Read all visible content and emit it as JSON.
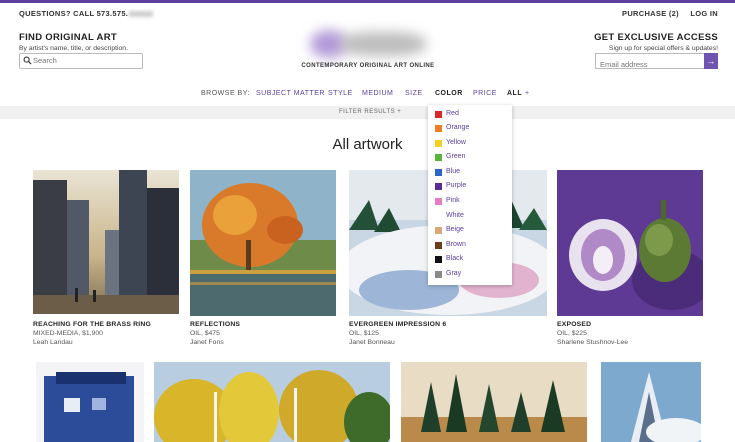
{
  "topbar": {
    "questions": "QUESTIONS? CALL 573.575.",
    "purchase": "PURCHASE (2)",
    "login": "LOG IN"
  },
  "find": {
    "heading": "FIND ORIGINAL ART",
    "subtitle": "By artist's name, title, or description.",
    "search_placeholder": "Search"
  },
  "logo": {
    "tagline": "CONTEMPORARY ORIGINAL ART ONLINE"
  },
  "exclusive": {
    "heading": "GET EXCLUSIVE ACCESS",
    "subtitle": "Sign up for special offers & updates!",
    "email_placeholder": "Email address",
    "submit_arrow": "→"
  },
  "nav": {
    "browse_label": "BROWSE BY:",
    "items": [
      "SUBJECT MATTER",
      "STYLE",
      "MEDIUM",
      "SIZE",
      "COLOR",
      "PRICE",
      "ALL",
      "+"
    ]
  },
  "filter": {
    "label": "FILTER RESULTS +"
  },
  "page_title": "All artwork",
  "color_menu": [
    {
      "label": "Red",
      "color": "#d8262b"
    },
    {
      "label": "Orange",
      "color": "#ef7d22"
    },
    {
      "label": "Yellow",
      "color": "#f4d122"
    },
    {
      "label": "Green",
      "color": "#5bb33a"
    },
    {
      "label": "Blue",
      "color": "#2a67c4"
    },
    {
      "label": "Purple",
      "color": "#5b2b98"
    },
    {
      "label": "Pink",
      "color": "#e77cc0"
    },
    {
      "label": "White",
      "color": "#ffffff"
    },
    {
      "label": "Beige",
      "color": "#d7a877"
    },
    {
      "label": "Brown",
      "color": "#6d3d1f"
    },
    {
      "label": "Black",
      "color": "#111111"
    },
    {
      "label": "Gray",
      "color": "#8a8a8a"
    }
  ],
  "artworks": [
    {
      "title": "REACHING FOR THE BRASS RING",
      "details": "MIXED-MEDIA, $1,900",
      "artist": "Leah Landau"
    },
    {
      "title": "REFLECTIONS",
      "details": "OIL, $475",
      "artist": "Janet Fons"
    },
    {
      "title": "EVERGREEN IMPRESSION 6",
      "details": "OIL, $125",
      "artist": "Janet Bonneau"
    },
    {
      "title": "EXPOSED",
      "details": "OIL, $225",
      "artist": "Sharlene Stushnov-Lee"
    }
  ],
  "colors": {
    "accent": "#5a3f9e",
    "button": "#6f55b0"
  }
}
